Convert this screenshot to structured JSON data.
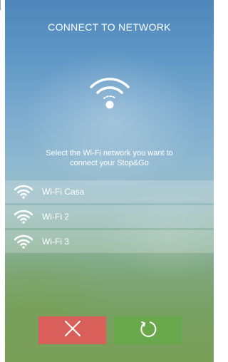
{
  "screen": {
    "title": "CONNECT TO NETWORK",
    "instruction_line1": "Select the Wi-Fi network you want to",
    "instruction_line2": "connect your Stop&Go",
    "hero_icon": "wifi-searching-icon"
  },
  "networks": [
    {
      "name": "Wi-Fi Casa",
      "icon": "wifi-icon",
      "signal_bars": 3
    },
    {
      "name": "Wi-Fi 2",
      "icon": "wifi-icon",
      "signal_bars": 3
    },
    {
      "name": "Wi-Fi 3",
      "icon": "wifi-icon",
      "signal_bars": 3
    }
  ],
  "actions": {
    "cancel_icon": "close-icon",
    "refresh_icon": "refresh-icon"
  },
  "colors": {
    "cancel": "#d9605a",
    "refresh": "#6aa84c",
    "text": "#ffffff"
  }
}
